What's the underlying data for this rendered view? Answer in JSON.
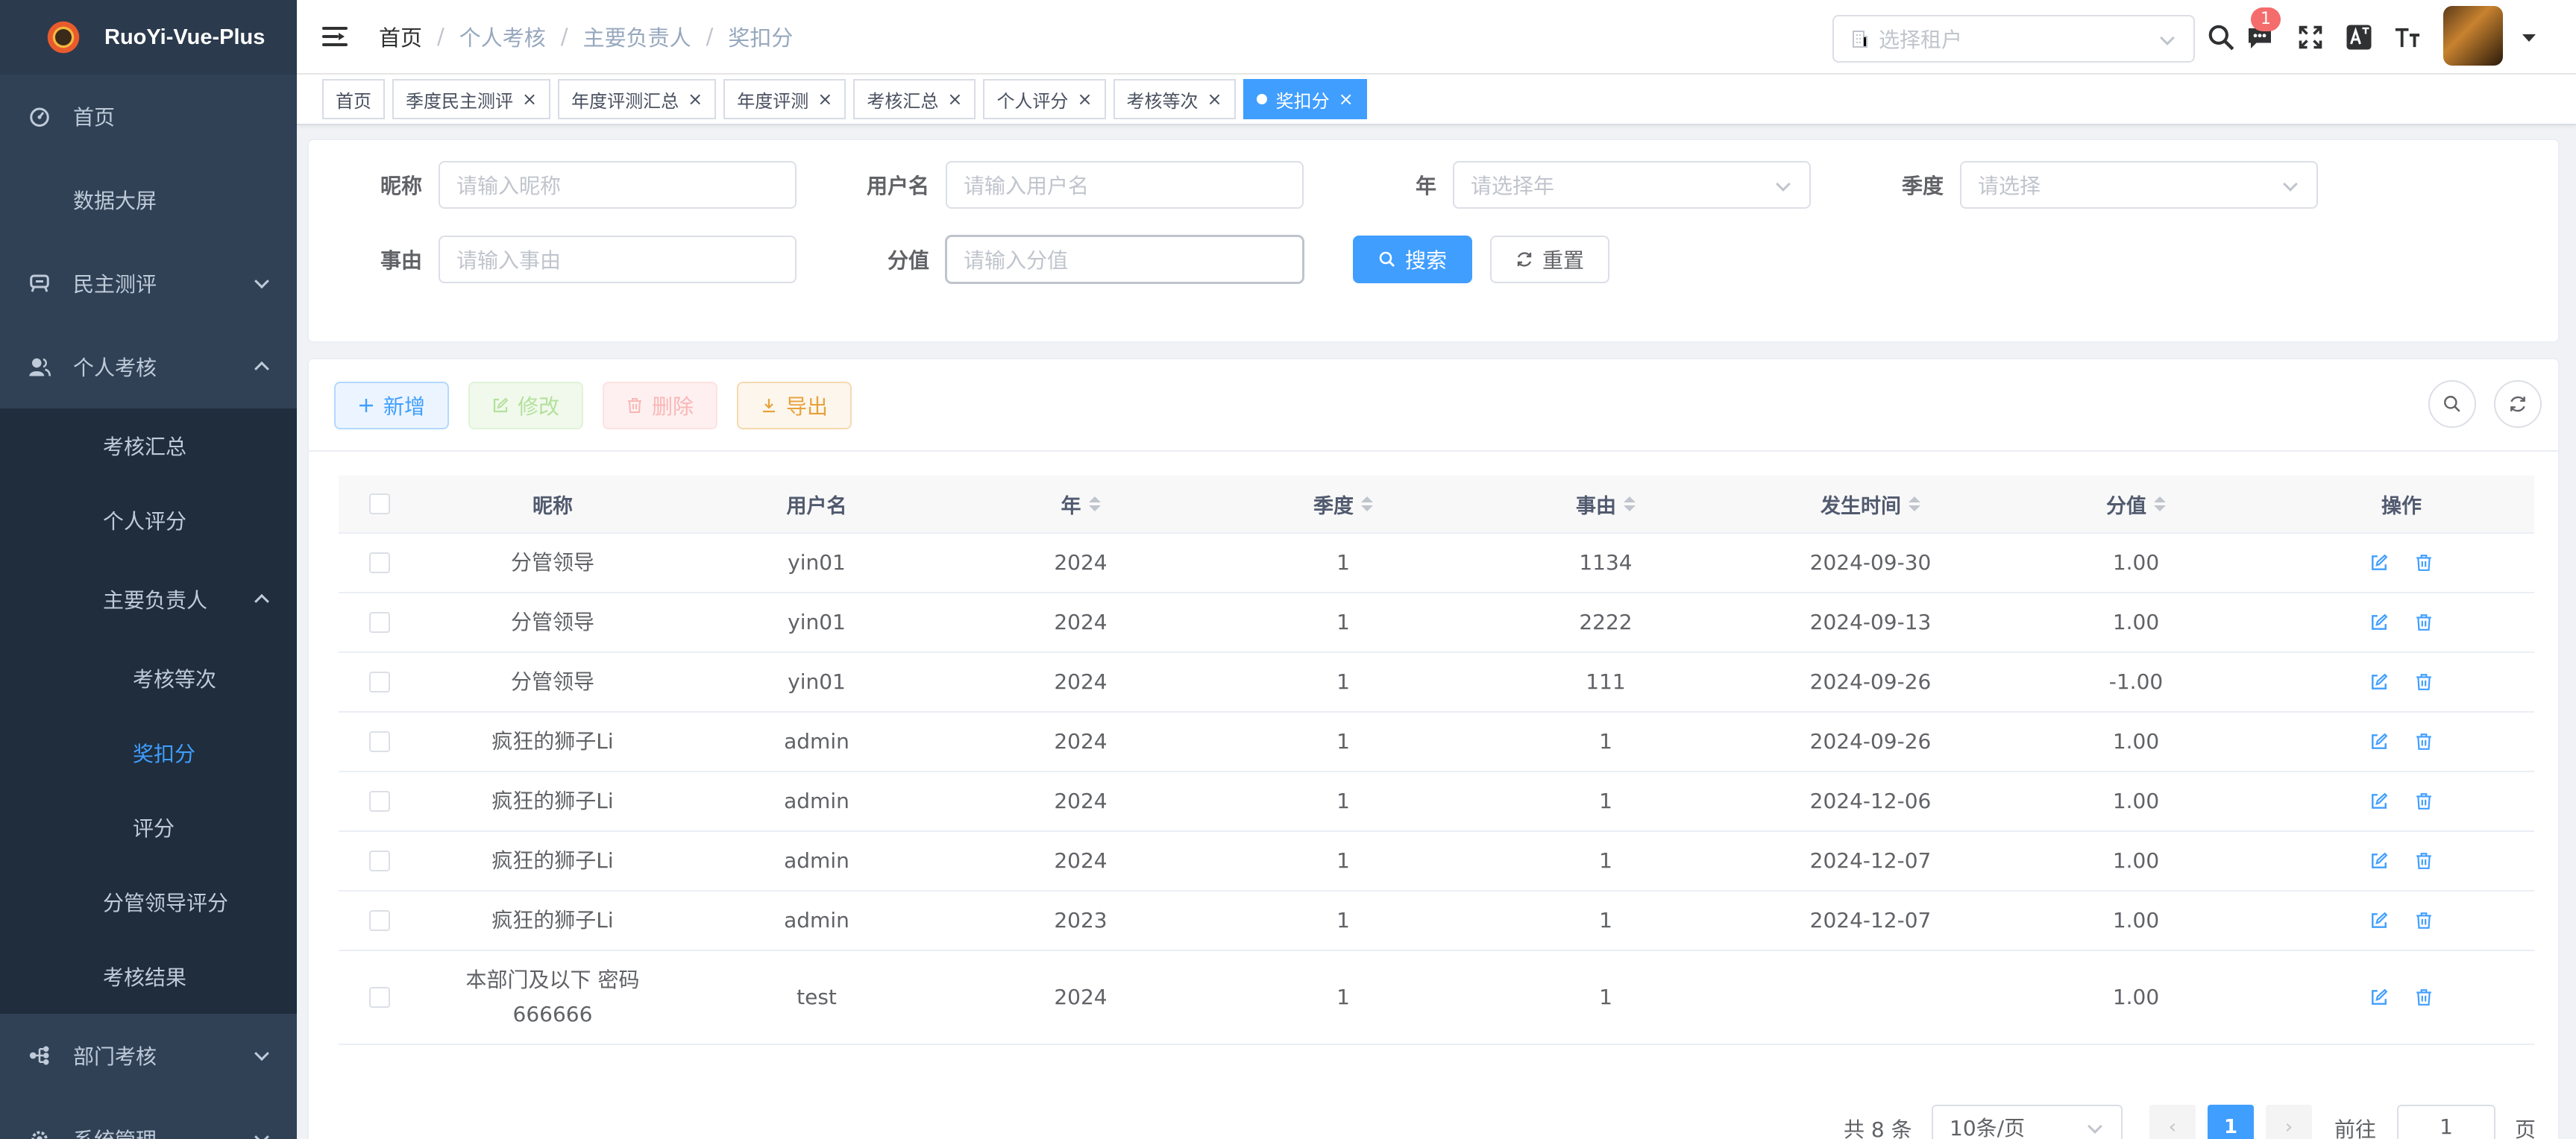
{
  "app": {
    "title": "RuoYi-Vue-Plus"
  },
  "sidebar": {
    "items": [
      {
        "label": "首页",
        "icon": "dashboard-icon"
      },
      {
        "label": "数据大屏"
      },
      {
        "label": "民主测评",
        "icon": "survey-icon",
        "state": "collapsed"
      },
      {
        "label": "个人考核",
        "icon": "user-icon",
        "state": "expanded"
      }
    ],
    "personal_sub": [
      {
        "label": "考核汇总"
      },
      {
        "label": "个人评分"
      },
      {
        "label": "主要负责人",
        "state": "expanded"
      }
    ],
    "leader_sub": [
      {
        "label": "考核等次"
      },
      {
        "label": "奖扣分",
        "active": true
      },
      {
        "label": "评分"
      }
    ],
    "personal_sub2": [
      {
        "label": "分管领导评分"
      },
      {
        "label": "考核结果"
      }
    ],
    "bottom_items": [
      {
        "label": "部门考核",
        "icon": "tree-icon",
        "state": "collapsed"
      },
      {
        "label": "系统管理",
        "icon": "gear-icon",
        "state": "collapsed"
      }
    ]
  },
  "navbar": {
    "breadcrumb": [
      "首页",
      "个人考核",
      "主要负责人",
      "奖扣分"
    ],
    "tenant_placeholder": "选择租户",
    "message_badge": "1"
  },
  "tags": [
    {
      "label": "首页",
      "closable": false
    },
    {
      "label": "季度民主测评",
      "closable": true
    },
    {
      "label": "年度评测汇总",
      "closable": true
    },
    {
      "label": "年度评测",
      "closable": true
    },
    {
      "label": "考核汇总",
      "closable": true
    },
    {
      "label": "个人评分",
      "closable": true
    },
    {
      "label": "考核等次",
      "closable": true
    },
    {
      "label": "奖扣分",
      "closable": true,
      "active": true
    }
  ],
  "search_form": {
    "nickname_label": "昵称",
    "nickname_placeholder": "请输入昵称",
    "username_label": "用户名",
    "username_placeholder": "请输入用户名",
    "year_label": "年",
    "year_placeholder": "请选择年",
    "quarter_label": "季度",
    "quarter_placeholder": "请选择",
    "reason_label": "事由",
    "reason_placeholder": "请输入事由",
    "score_label": "分值",
    "score_placeholder": "请输入分值",
    "search_button": "搜索",
    "reset_button": "重置"
  },
  "toolbar": {
    "add": "新增",
    "edit": "修改",
    "delete": "删除",
    "export": "导出"
  },
  "table": {
    "columns": [
      "昵称",
      "用户名",
      "年",
      "季度",
      "事由",
      "发生时间",
      "分值",
      "操作"
    ],
    "sortable": [
      false,
      false,
      true,
      true,
      true,
      true,
      true,
      false
    ],
    "rows": [
      {
        "nickname": "分管领导",
        "username": "yin01",
        "year": "2024",
        "quarter": "1",
        "reason": "1134",
        "time": "2024-09-30",
        "score": "1.00"
      },
      {
        "nickname": "分管领导",
        "username": "yin01",
        "year": "2024",
        "quarter": "1",
        "reason": "2222",
        "time": "2024-09-13",
        "score": "1.00"
      },
      {
        "nickname": "分管领导",
        "username": "yin01",
        "year": "2024",
        "quarter": "1",
        "reason": "111",
        "time": "2024-09-26",
        "score": "-1.00"
      },
      {
        "nickname": "疯狂的狮子Li",
        "username": "admin",
        "year": "2024",
        "quarter": "1",
        "reason": "1",
        "time": "2024-09-26",
        "score": "1.00"
      },
      {
        "nickname": "疯狂的狮子Li",
        "username": "admin",
        "year": "2024",
        "quarter": "1",
        "reason": "1",
        "time": "2024-12-06",
        "score": "1.00"
      },
      {
        "nickname": "疯狂的狮子Li",
        "username": "admin",
        "year": "2024",
        "quarter": "1",
        "reason": "1",
        "time": "2024-12-07",
        "score": "1.00"
      },
      {
        "nickname": "疯狂的狮子Li",
        "username": "admin",
        "year": "2023",
        "quarter": "1",
        "reason": "1",
        "time": "2024-12-07",
        "score": "1.00"
      },
      {
        "nickname": "本部门及以下 密码 666666",
        "username": "test",
        "year": "2024",
        "quarter": "1",
        "reason": "1",
        "time": "",
        "score": "1.00"
      }
    ]
  },
  "pagination": {
    "total": "共 8 条",
    "page_size": "10条/页",
    "current": "1",
    "goto_label": "前往",
    "goto_value": "1",
    "page_suffix": "页"
  },
  "colors": {
    "sidebar_bg": "#304156",
    "sidebar_sub_bg": "#1f2d3d",
    "primary": "#409eff",
    "danger": "#f56c6c",
    "warning": "#e6a23c",
    "success": "#67c23a"
  }
}
